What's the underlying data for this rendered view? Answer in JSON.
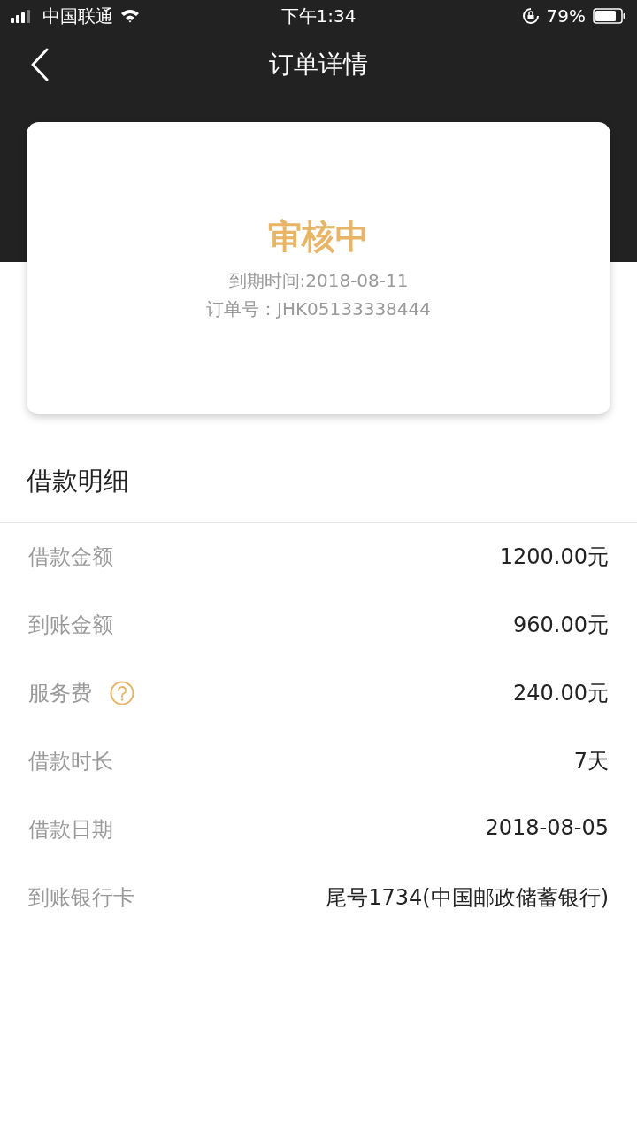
{
  "status_bar": {
    "carrier": "中国联通",
    "time": "下午1:34",
    "battery": "79%"
  },
  "nav": {
    "title": "订单详情"
  },
  "order_card": {
    "status": "审核中",
    "due": "到期时间:2018-08-11",
    "order_no": "订单号：JHK05133338444"
  },
  "section": {
    "title": "借款明细"
  },
  "rows": [
    {
      "label": "借款金额",
      "value": "1200.00元",
      "help": false
    },
    {
      "label": "到账金额",
      "value": "960.00元",
      "help": false
    },
    {
      "label": "服务费",
      "value": "240.00元",
      "help": true
    },
    {
      "label": "借款时长",
      "value": "7天",
      "help": false
    },
    {
      "label": "借款日期",
      "value": "2018-08-05",
      "help": false
    },
    {
      "label": "到账银行卡",
      "value": "尾号1734(中国邮政储蓄银行)",
      "help": false
    }
  ]
}
